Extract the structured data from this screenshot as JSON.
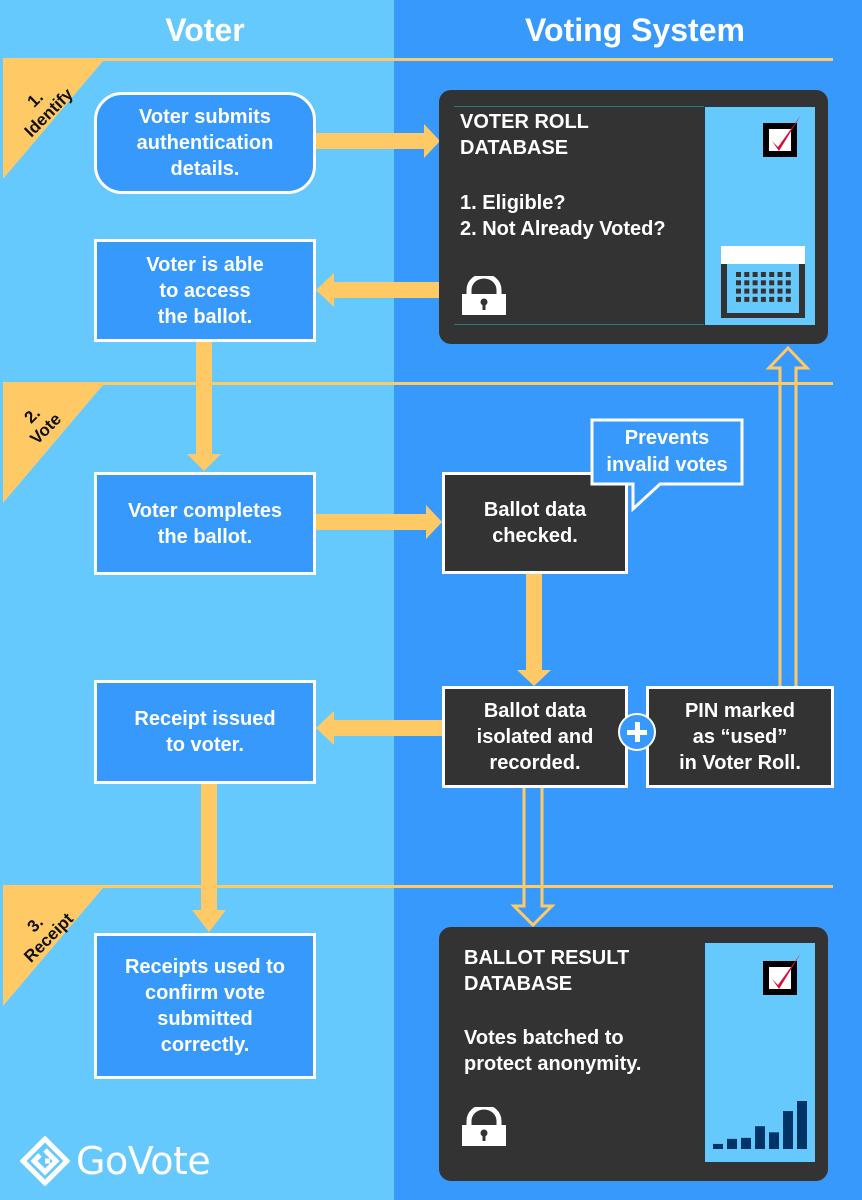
{
  "lanes": {
    "voter": "Voter",
    "system": "Voting System"
  },
  "stages": [
    {
      "number": "1.",
      "name": "Identify"
    },
    {
      "number": "2.",
      "name": "Vote"
    },
    {
      "number": "3.",
      "name": "Receipt"
    }
  ],
  "voter_steps": {
    "submit": "Voter submits\nauthentication\ndetails.",
    "access": "Voter is able\nto access\nthe ballot.",
    "complete": "Voter completes\nthe ballot.",
    "receipt_issued": "Receipt issued\nto voter.",
    "receipts_used": "Receipts used to\nconfirm vote\nsubmitted\ncorrectly."
  },
  "system_steps": {
    "voter_roll_db": {
      "title": "VOTER ROLL\nDATABASE",
      "checks": "1. Eligible?\n2. Not Already Voted?"
    },
    "checked": "Ballot data\nchecked.",
    "callout": "Prevents\ninvalid votes",
    "isolated": "Ballot data\nisolated and\nrecorded.",
    "pin_marked": "PIN marked\nas “used”\nin Voter Roll.",
    "ballot_result_db": {
      "title": "BALLOT RESULT\nDATABASE",
      "description": "Votes batched to\nprotect anonymity."
    }
  },
  "result_bars": [
    1,
    2,
    2.2,
    4.5,
    3.3,
    7.5,
    9.5
  ],
  "brand": {
    "name": "GoVote"
  },
  "colors": {
    "voter_lane": "#66c9fd",
    "system_lane": "#3899fd",
    "accent": "#ffc966",
    "dark_box": "#333333",
    "check_red": "#d0103a",
    "bar_navy": "#003366"
  }
}
